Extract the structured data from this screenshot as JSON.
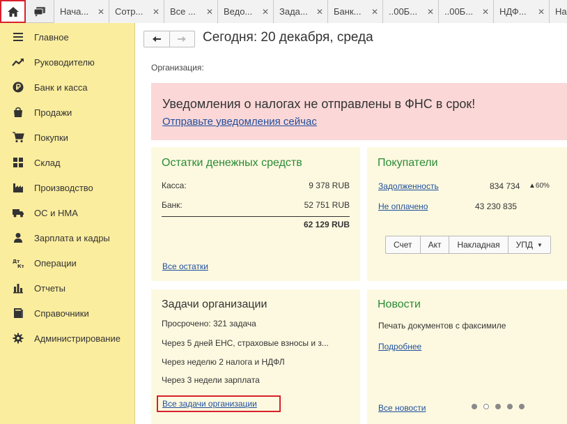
{
  "tabs": [
    {
      "label": "Нача..."
    },
    {
      "label": "Сотр..."
    },
    {
      "label": "Все ..."
    },
    {
      "label": "Ведо..."
    },
    {
      "label": "Зада..."
    },
    {
      "label": "Банк..."
    },
    {
      "label": "..00Б..."
    },
    {
      "label": "..00Б..."
    },
    {
      "label": "НДФ..."
    },
    {
      "label": "На"
    }
  ],
  "sidebar": {
    "items": [
      {
        "label": "Главное",
        "icon": "menu-icon"
      },
      {
        "label": "Руководителю",
        "icon": "trend-icon"
      },
      {
        "label": "Банк и касса",
        "icon": "ruble-icon"
      },
      {
        "label": "Продажи",
        "icon": "bag-icon"
      },
      {
        "label": "Покупки",
        "icon": "cart-icon"
      },
      {
        "label": "Склад",
        "icon": "grid-icon"
      },
      {
        "label": "Производство",
        "icon": "factory-icon"
      },
      {
        "label": "ОС и НМА",
        "icon": "truck-icon"
      },
      {
        "label": "Зарплата и кадры",
        "icon": "person-icon"
      },
      {
        "label": "Операции",
        "icon": "dt-kt-icon"
      },
      {
        "label": "Отчеты",
        "icon": "bar-chart-icon"
      },
      {
        "label": "Справочники",
        "icon": "book-icon"
      },
      {
        "label": "Администрирование",
        "icon": "gear-icon"
      }
    ]
  },
  "header": {
    "title": "Сегодня: 20 декабря, среда",
    "org_label": "Организация:"
  },
  "alert": {
    "title": "Уведомления о налогах не отправлены в ФНС в срок!",
    "link": "Отправьте уведомления сейчас",
    "color": "#fbd7d7"
  },
  "cash": {
    "title": "Остатки денежных средств",
    "rows": [
      {
        "label": "Касса:",
        "value": "9 378 RUB"
      },
      {
        "label": "Банк:",
        "value": "52 751 RUB"
      }
    ],
    "total": "62 129 RUB",
    "link": "Все остатки"
  },
  "customers": {
    "title": "Покупатели",
    "debt_label": "Задолженность",
    "debt_value": "834 734",
    "debt_change": "▲60%",
    "unpaid_label": "Не оплачено",
    "unpaid_value": "43 230 835",
    "buttons": [
      "Счет",
      "Акт",
      "Накладная",
      "УПД"
    ]
  },
  "tasks": {
    "title": "Задачи организации",
    "items": [
      "Просрочено: 321 задача",
      "Через 5 дней ЕНС, страховые взносы и з...",
      "Через неделю 2 налога и НДФЛ",
      "Через 3 недели зарплата"
    ],
    "link": "Все задачи организации"
  },
  "news": {
    "title": "Новости",
    "item": "Печать документов с факсимиле",
    "more_link": "Подробнее",
    "all_link": "Все новости",
    "active_dot": 1
  },
  "colors": {
    "sidebar": "#fbed9e",
    "card": "#fdf9e0",
    "green_title": "#2a8a36",
    "link": "#1e4e9c",
    "highlight": "#d8202a"
  }
}
